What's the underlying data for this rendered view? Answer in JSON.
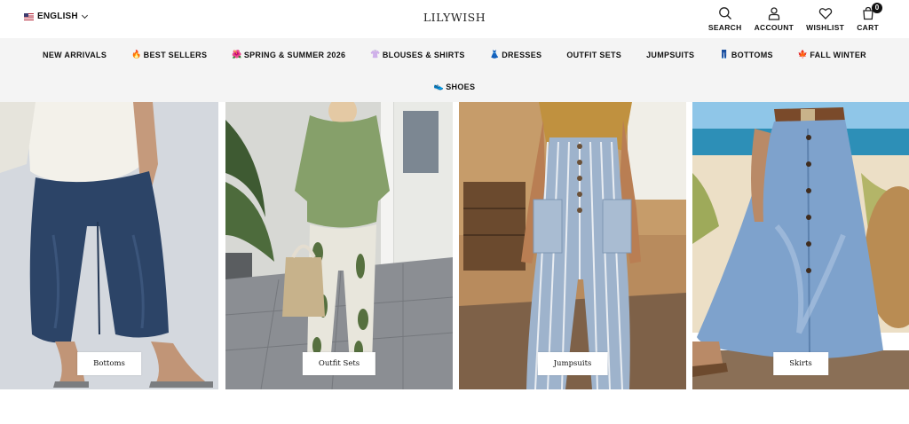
{
  "header": {
    "language": "ENGLISH",
    "logo": "LILYWISH",
    "tools": [
      {
        "name": "search",
        "label": "SEARCH",
        "icon": "search-icon"
      },
      {
        "name": "account",
        "label": "ACCOUNT",
        "icon": "user-icon"
      },
      {
        "name": "wishlist",
        "label": "WISHLIST",
        "icon": "heart-icon"
      },
      {
        "name": "cart",
        "label": "CART",
        "icon": "bag-icon",
        "count": "0"
      }
    ]
  },
  "nav": {
    "items": [
      {
        "label": "NEW ARRIVALS",
        "emoji": ""
      },
      {
        "label": "BEST SELLERS",
        "emoji": "🔥"
      },
      {
        "label": "SPRING & SUMMER 2026",
        "emoji": "🌺"
      },
      {
        "label": "BLOUSES & SHIRTS",
        "emoji": "👚"
      },
      {
        "label": "DRESSES",
        "emoji": "👗"
      },
      {
        "label": "OUTFIT SETS",
        "emoji": ""
      },
      {
        "label": "JUMPSUITS",
        "emoji": ""
      },
      {
        "label": "BOTTOMS",
        "emoji": "👖"
      },
      {
        "label": "FALL WINTER",
        "emoji": "🍁"
      },
      {
        "label": "SHOES",
        "emoji": "👟"
      }
    ]
  },
  "categories": [
    {
      "label": "Bottoms",
      "image": "navy-linen-pants-photo"
    },
    {
      "label": "Outfit Sets",
      "image": "green-top-floral-pants-photo"
    },
    {
      "label": "Jumpsuits",
      "image": "striped-denim-jumpsuit-photo"
    },
    {
      "label": "Skirts",
      "image": "blue-button-skirt-photo"
    }
  ],
  "colors": {
    "nav_bg": "#f4f4f4",
    "text": "#111111",
    "badge_bg": "#111111"
  }
}
